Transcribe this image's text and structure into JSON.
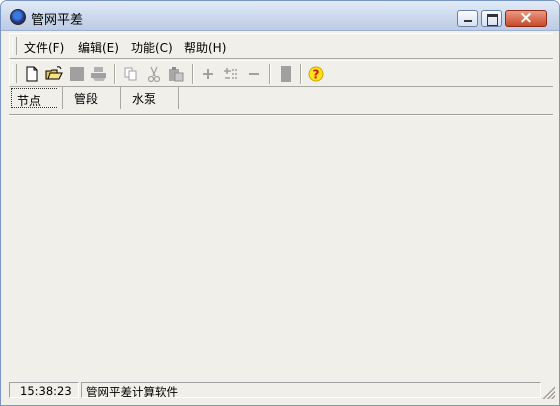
{
  "window": {
    "title": "管网平差"
  },
  "menu": {
    "items": [
      {
        "label": "文件(F)"
      },
      {
        "label": "编辑(E)"
      },
      {
        "label": "功能(C)"
      },
      {
        "label": "帮助(H)"
      }
    ]
  },
  "toolbar": {
    "icons": [
      "new-file-icon",
      "open-folder-icon",
      "save-icon",
      "print-icon",
      "copy-icon",
      "cut-icon",
      "paste-icon",
      "add-icon",
      "insert-icon",
      "remove-icon",
      "stop-icon",
      "help-icon"
    ]
  },
  "tabs": {
    "items": [
      {
        "label": "节点"
      },
      {
        "label": "管段"
      },
      {
        "label": "水泵"
      }
    ]
  },
  "status": {
    "time": "15:38:23",
    "message": "管网平差计算软件"
  },
  "colors": {
    "title_bar": "#cfdcef",
    "window_bg": "#f0efea",
    "help_icon": "#ffe21a",
    "close_button": "#c9492a"
  }
}
